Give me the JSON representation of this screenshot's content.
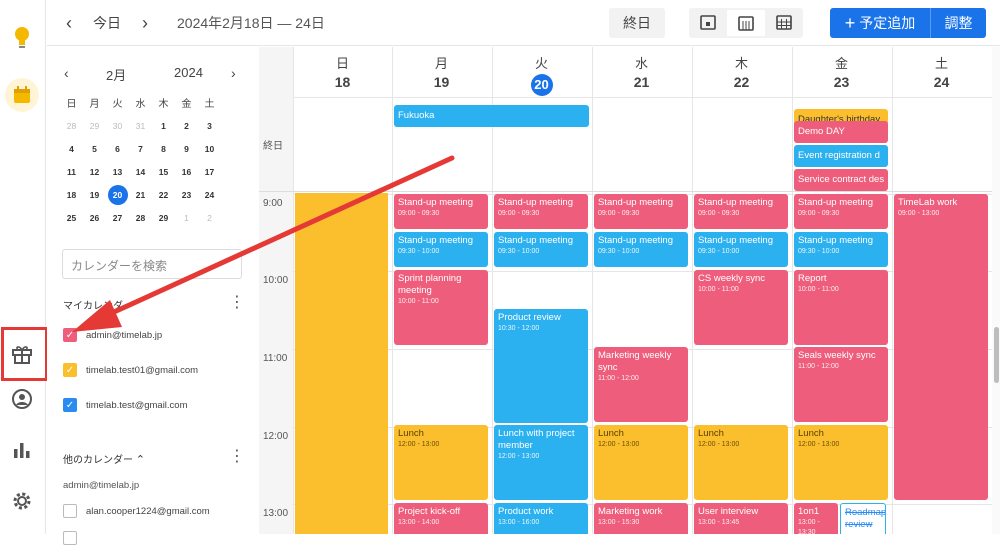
{
  "rail": {
    "icons": [
      "bulb-icon",
      "calendar-icon",
      "gift-icon",
      "user-icon",
      "chart-icon",
      "gear-icon"
    ]
  },
  "header": {
    "today": "今日",
    "range": "2024年2月18日 — 24日",
    "allday": "終日",
    "add": "予定追加",
    "adjust": "調整"
  },
  "mini": {
    "month": "2月",
    "year": "2024",
    "weekdays": [
      "日",
      "月",
      "火",
      "水",
      "木",
      "金",
      "土"
    ],
    "weeks": [
      [
        "28",
        "29",
        "30",
        "31",
        "1",
        "2",
        "3"
      ],
      [
        "4",
        "5",
        "6",
        "7",
        "8",
        "9",
        "10"
      ],
      [
        "11",
        "12",
        "13",
        "14",
        "15",
        "16",
        "17"
      ],
      [
        "18",
        "19",
        "20",
        "21",
        "22",
        "23",
        "24"
      ],
      [
        "25",
        "26",
        "27",
        "28",
        "29",
        "1",
        "2"
      ]
    ]
  },
  "search": {
    "placeholder": "カレンダーを検索"
  },
  "my_calendars": {
    "title": "マイカレンダー",
    "items": [
      {
        "label": "admin@timelab.jp",
        "color": "#ee5d7b"
      },
      {
        "label": "timelab.test01@gmail.com",
        "color": "#fbbf2e"
      },
      {
        "label": "timelab.test@gmail.com",
        "color": "#2b8cf0"
      }
    ]
  },
  "other_calendars": {
    "title": "他のカレンダー",
    "owner": "admin@timelab.jp",
    "items": [
      {
        "label": "alan.cooper1224@gmail.com"
      }
    ]
  },
  "days": [
    {
      "w": "日",
      "d": "18"
    },
    {
      "w": "月",
      "d": "19"
    },
    {
      "w": "火",
      "d": "20"
    },
    {
      "w": "水",
      "d": "21"
    },
    {
      "w": "木",
      "d": "22"
    },
    {
      "w": "金",
      "d": "23"
    },
    {
      "w": "土",
      "d": "24"
    }
  ],
  "allday_label": "終日",
  "times": [
    "9:00",
    "10:00",
    "11:00",
    "12:00",
    "13:00"
  ],
  "allday_events": [
    {
      "title": "Fukuoka",
      "color": "blue"
    },
    {
      "title": "Daughter's birthday",
      "color": "yellow"
    },
    {
      "title": "Demo DAY",
      "color": "pink"
    },
    {
      "title": "Event registration d",
      "color": "blue"
    },
    {
      "title": "Service contract des",
      "color": "pink"
    }
  ],
  "events": [
    {
      "t": "Stand-up meeting",
      "tm": "09:00 - 09:30"
    },
    {
      "t": "Stand-up meeting",
      "tm": "09:30 - 10:00"
    },
    {
      "t": "Sprint planning meeting",
      "tm": "10:00 - 11:00"
    },
    {
      "t": "Lunch",
      "tm": "12:00 - 13:00"
    },
    {
      "t": "Project kick-off",
      "tm": "13:00 - 14:00"
    },
    {
      "t": "Stand-up meeting",
      "tm": "09:00 - 09:30"
    },
    {
      "t": "Stand-up meeting",
      "tm": "09:30 - 10:00"
    },
    {
      "t": "Product review",
      "tm": "10:30 - 12:00"
    },
    {
      "t": "Lunch with project member",
      "tm": "12:00 - 13:00"
    },
    {
      "t": "Product work",
      "tm": "13:00 - 16:00"
    },
    {
      "t": "Stand-up meeting",
      "tm": "09:00 - 09:30"
    },
    {
      "t": "Stand-up meeting",
      "tm": "09:30 - 10:00"
    },
    {
      "t": "Marketing weekly sync",
      "tm": "11:00 - 12:00"
    },
    {
      "t": "Lunch",
      "tm": "12:00 - 13:00"
    },
    {
      "t": "Marketing work",
      "tm": "13:00 - 15:30"
    },
    {
      "t": "Stand-up meeting",
      "tm": "09:00 - 09:30"
    },
    {
      "t": "Stand-up meeting",
      "tm": "09:30 - 10:00"
    },
    {
      "t": "CS weekly sync",
      "tm": "10:00 - 11:00"
    },
    {
      "t": "Lunch",
      "tm": "12:00 - 13:00"
    },
    {
      "t": "User interview",
      "tm": "13:00 - 13:45"
    },
    {
      "t": "Stand-up meeting",
      "tm": "09:00 - 09:30"
    },
    {
      "t": "Stand-up meeting",
      "tm": "09:30 - 10:00"
    },
    {
      "t": "Report",
      "tm": "10:00 - 11:00"
    },
    {
      "t": "Seals weekly sync",
      "tm": "11:00 - 12:00"
    },
    {
      "t": "Lunch",
      "tm": "12:00 - 13:00"
    },
    {
      "t": "1on1",
      "tm": "13:00 - 13:30"
    },
    {
      "t": "Roadmap review",
      "tm": ""
    },
    {
      "t": "TimeLab work",
      "tm": "09:00 - 13:00"
    }
  ]
}
